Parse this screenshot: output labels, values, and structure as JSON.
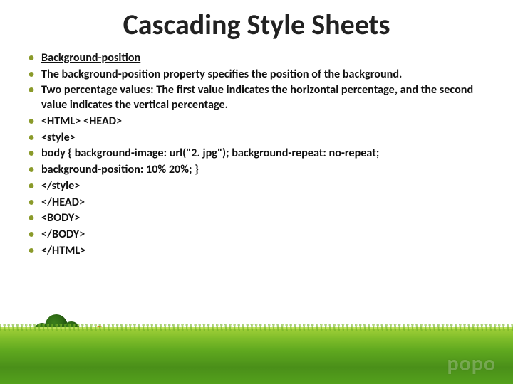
{
  "title": "Cascading Style Sheets",
  "bullets": [
    "Background-position",
    "The background-position property specifies the position of the background.",
    "Two percentage values: The first value indicates the horizontal percentage, and the second value indicates the vertical percentage.",
    "<HTML> <HEAD>",
    " <style>",
    " body { background-image: url(\"2. jpg\");   background-repeat: no-repeat;",
    " background-position: 10% 20%; }",
    " </style>",
    " </HEAD>",
    " <BODY>",
    " </BODY>",
    "</HTML>"
  ],
  "watermark": "popo"
}
